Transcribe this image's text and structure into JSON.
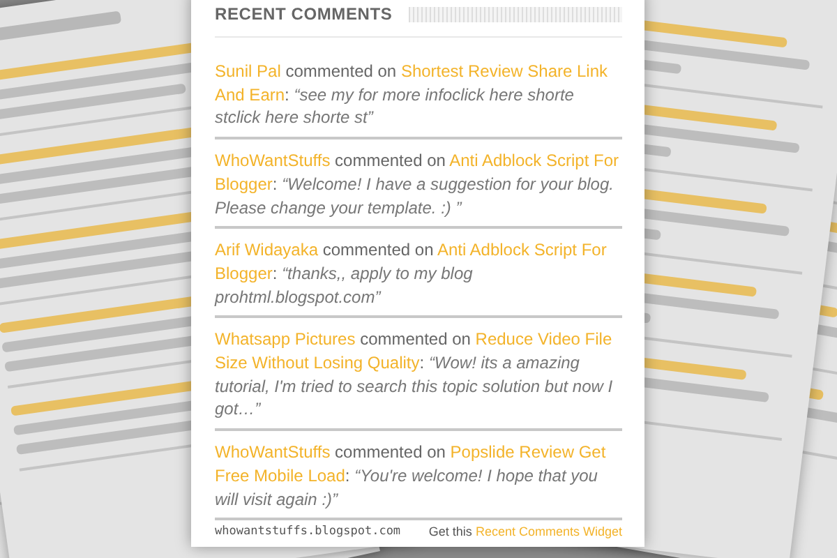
{
  "widget": {
    "title": "RECENT COMMENTS",
    "comments": [
      {
        "author": "Sunil Pal",
        "verb": "commented on",
        "post": "Shortest Review Share Link And Earn",
        "separator": ":",
        "excerpt": "“see my for more infoclick here shorte stclick here shorte st”"
      },
      {
        "author": "WhoWantStuffs",
        "verb": "commented on",
        "post": "Anti Adblock Script For Blogger",
        "separator": ":",
        "excerpt": "“Welcome! I have a suggestion for your blog. Please change your template. :) ”"
      },
      {
        "author": "Arif Widayaka",
        "verb": "commented on",
        "post": "Anti Adblock Script For Blogger",
        "separator": ":",
        "excerpt": "“thanks,, apply to my blog prohtml.blogspot.com”"
      },
      {
        "author": "Whatsapp Pictures",
        "verb": "commented on",
        "post": "Reduce Video File Size Without Losing Quality",
        "separator": ":",
        "excerpt": "“Wow! its a amazing tutorial, I'm tried to search this topic solution but now I got…”"
      },
      {
        "author": "WhoWantStuffs",
        "verb": "commented on",
        "post": "Popslide Review Get Free Mobile Load",
        "separator": ":",
        "excerpt": "“You're welcome! I hope that you will visit again :)”"
      }
    ],
    "footer": {
      "site": "whowantstuffs.blogspot.com",
      "prefix": "Get this",
      "link": "Recent Comments Widget"
    }
  }
}
